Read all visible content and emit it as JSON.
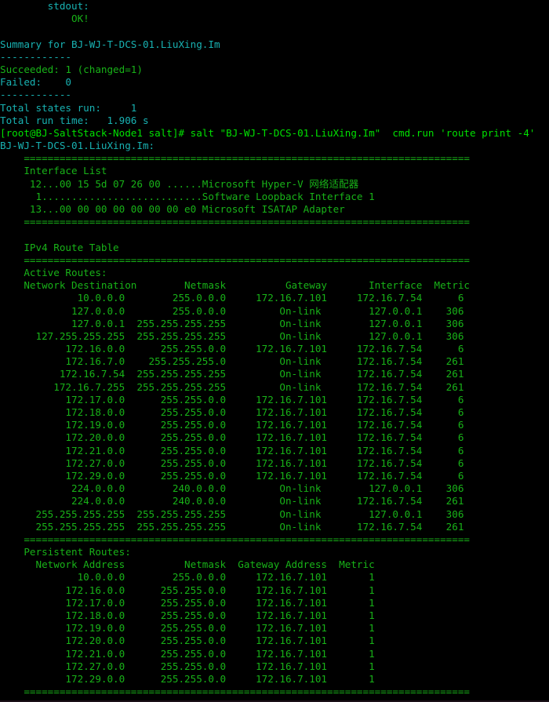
{
  "terminal": {
    "background": "#000000",
    "colors": {
      "cyan": "#18b2b2",
      "green": "#18b218",
      "bright_green": "#00e000"
    },
    "lines": [
      {
        "id": "l01",
        "segments": [
          {
            "text": "        stdout:",
            "color": "cyan"
          }
        ]
      },
      {
        "id": "l02",
        "segments": [
          {
            "text": "            OK!",
            "color": "green"
          }
        ]
      },
      {
        "id": "l03",
        "segments": [
          {
            "text": "",
            "color": "green"
          }
        ]
      },
      {
        "id": "l04",
        "segments": [
          {
            "text": "Summary for BJ-WJ-T-DCS-01.LiuXing.Im",
            "color": "cyan"
          }
        ]
      },
      {
        "id": "l05",
        "segments": [
          {
            "text": "------------",
            "color": "cyan"
          }
        ]
      },
      {
        "id": "l06",
        "segments": [
          {
            "text": "Succeeded: 1 (changed=1)",
            "color": "green"
          }
        ]
      },
      {
        "id": "l07",
        "segments": [
          {
            "text": "Failed:    0",
            "color": "cyan"
          }
        ]
      },
      {
        "id": "l08",
        "segments": [
          {
            "text": "------------",
            "color": "cyan"
          }
        ]
      },
      {
        "id": "l09",
        "segments": [
          {
            "text": "Total states run:     1",
            "color": "cyan"
          }
        ]
      },
      {
        "id": "l10",
        "segments": [
          {
            "text": "Total run time:   1.906 s",
            "color": "cyan"
          }
        ]
      },
      {
        "id": "l11",
        "segments": [
          {
            "text": "[root@BJ-SaltStack-Node1 salt]# salt \"BJ-WJ-T-DCS-01.LiuXing.Im\"  cmd.run 'route print -4'",
            "color": "bright_green"
          }
        ]
      },
      {
        "id": "l12",
        "segments": [
          {
            "text": "BJ-WJ-T-DCS-01.LiuXing.Im:",
            "color": "cyan"
          }
        ]
      },
      {
        "id": "l13",
        "segments": [
          {
            "text": "    ===========================================================================",
            "color": "green"
          }
        ]
      },
      {
        "id": "l14",
        "segments": [
          {
            "text": "    Interface List",
            "color": "green"
          }
        ]
      },
      {
        "id": "l15",
        "segments": [
          {
            "text": "     12...00 15 5d 07 26 00 ......Microsoft Hyper-V 网络适配器",
            "color": "green"
          }
        ]
      },
      {
        "id": "l16",
        "segments": [
          {
            "text": "      1...........................Software Loopback Interface 1",
            "color": "green"
          }
        ]
      },
      {
        "id": "l17",
        "segments": [
          {
            "text": "     13...00 00 00 00 00 00 00 e0 Microsoft ISATAP Adapter",
            "color": "green"
          }
        ]
      },
      {
        "id": "l18",
        "segments": [
          {
            "text": "    ===========================================================================",
            "color": "green"
          }
        ]
      },
      {
        "id": "l19",
        "segments": [
          {
            "text": "",
            "color": "green"
          }
        ]
      },
      {
        "id": "l20",
        "segments": [
          {
            "text": "    IPv4 Route Table",
            "color": "green"
          }
        ]
      },
      {
        "id": "l21",
        "segments": [
          {
            "text": "    ===========================================================================",
            "color": "green"
          }
        ]
      },
      {
        "id": "l22",
        "segments": [
          {
            "text": "    Active Routes:",
            "color": "green"
          }
        ]
      },
      {
        "id": "l23",
        "segments": [
          {
            "text": "    Network Destination        Netmask          Gateway       Interface  Metric",
            "color": "green"
          }
        ]
      },
      {
        "id": "l24",
        "segments": [
          {
            "text": "             10.0.0.0        255.0.0.0     172.16.7.101     172.16.7.54      6",
            "color": "green"
          }
        ]
      },
      {
        "id": "l25",
        "segments": [
          {
            "text": "            127.0.0.0        255.0.0.0         On-link        127.0.0.1    306",
            "color": "green"
          }
        ]
      },
      {
        "id": "l26",
        "segments": [
          {
            "text": "            127.0.0.1  255.255.255.255         On-link        127.0.0.1    306",
            "color": "green"
          }
        ]
      },
      {
        "id": "l27",
        "segments": [
          {
            "text": "      127.255.255.255  255.255.255.255         On-link        127.0.0.1    306",
            "color": "green"
          }
        ]
      },
      {
        "id": "l28",
        "segments": [
          {
            "text": "           172.16.0.0      255.255.0.0     172.16.7.101     172.16.7.54      6",
            "color": "green"
          }
        ]
      },
      {
        "id": "l29",
        "segments": [
          {
            "text": "           172.16.7.0    255.255.255.0         On-link      172.16.7.54    261",
            "color": "green"
          }
        ]
      },
      {
        "id": "l30",
        "segments": [
          {
            "text": "          172.16.7.54  255.255.255.255         On-link      172.16.7.54    261",
            "color": "green"
          }
        ]
      },
      {
        "id": "l31",
        "segments": [
          {
            "text": "         172.16.7.255  255.255.255.255         On-link      172.16.7.54    261",
            "color": "green"
          }
        ]
      },
      {
        "id": "l32",
        "segments": [
          {
            "text": "           172.17.0.0      255.255.0.0     172.16.7.101     172.16.7.54      6",
            "color": "green"
          }
        ]
      },
      {
        "id": "l33",
        "segments": [
          {
            "text": "           172.18.0.0      255.255.0.0     172.16.7.101     172.16.7.54      6",
            "color": "green"
          }
        ]
      },
      {
        "id": "l34",
        "segments": [
          {
            "text": "           172.19.0.0      255.255.0.0     172.16.7.101     172.16.7.54      6",
            "color": "green"
          }
        ]
      },
      {
        "id": "l35",
        "segments": [
          {
            "text": "           172.20.0.0      255.255.0.0     172.16.7.101     172.16.7.54      6",
            "color": "green"
          }
        ]
      },
      {
        "id": "l36",
        "segments": [
          {
            "text": "           172.21.0.0      255.255.0.0     172.16.7.101     172.16.7.54      6",
            "color": "green"
          }
        ]
      },
      {
        "id": "l37",
        "segments": [
          {
            "text": "           172.27.0.0      255.255.0.0     172.16.7.101     172.16.7.54      6",
            "color": "green"
          }
        ]
      },
      {
        "id": "l38",
        "segments": [
          {
            "text": "           172.29.0.0      255.255.0.0     172.16.7.101     172.16.7.54      6",
            "color": "green"
          }
        ]
      },
      {
        "id": "l39",
        "segments": [
          {
            "text": "            224.0.0.0        240.0.0.0         On-link        127.0.0.1    306",
            "color": "green"
          }
        ]
      },
      {
        "id": "l40",
        "segments": [
          {
            "text": "            224.0.0.0        240.0.0.0         On-link      172.16.7.54    261",
            "color": "green"
          }
        ]
      },
      {
        "id": "l41",
        "segments": [
          {
            "text": "      255.255.255.255  255.255.255.255         On-link        127.0.0.1    306",
            "color": "green"
          }
        ]
      },
      {
        "id": "l42",
        "segments": [
          {
            "text": "      255.255.255.255  255.255.255.255         On-link      172.16.7.54    261",
            "color": "green"
          }
        ]
      },
      {
        "id": "l43",
        "segments": [
          {
            "text": "    ===========================================================================",
            "color": "green"
          }
        ]
      },
      {
        "id": "l44",
        "segments": [
          {
            "text": "    Persistent Routes:",
            "color": "green"
          }
        ]
      },
      {
        "id": "l45",
        "segments": [
          {
            "text": "      Network Address          Netmask  Gateway Address  Metric",
            "color": "green"
          }
        ]
      },
      {
        "id": "l46",
        "segments": [
          {
            "text": "             10.0.0.0        255.0.0.0     172.16.7.101       1",
            "color": "green"
          }
        ]
      },
      {
        "id": "l47",
        "segments": [
          {
            "text": "           172.16.0.0      255.255.0.0     172.16.7.101       1",
            "color": "green"
          }
        ]
      },
      {
        "id": "l48",
        "segments": [
          {
            "text": "           172.17.0.0      255.255.0.0     172.16.7.101       1",
            "color": "green"
          }
        ]
      },
      {
        "id": "l49",
        "segments": [
          {
            "text": "           172.18.0.0      255.255.0.0     172.16.7.101       1",
            "color": "green"
          }
        ]
      },
      {
        "id": "l50",
        "segments": [
          {
            "text": "           172.19.0.0      255.255.0.0     172.16.7.101       1",
            "color": "green"
          }
        ]
      },
      {
        "id": "l51",
        "segments": [
          {
            "text": "           172.20.0.0      255.255.0.0     172.16.7.101       1",
            "color": "green"
          }
        ]
      },
      {
        "id": "l52",
        "segments": [
          {
            "text": "           172.21.0.0      255.255.0.0     172.16.7.101       1",
            "color": "green"
          }
        ]
      },
      {
        "id": "l53",
        "segments": [
          {
            "text": "           172.27.0.0      255.255.0.0     172.16.7.101       1",
            "color": "green"
          }
        ]
      },
      {
        "id": "l54",
        "segments": [
          {
            "text": "           172.29.0.0      255.255.0.0     172.16.7.101       1",
            "color": "green"
          }
        ]
      },
      {
        "id": "l55",
        "segments": [
          {
            "text": "    ===========================================================================",
            "color": "green"
          }
        ]
      }
    ]
  },
  "salt_summary": {
    "stdout_label": "stdout:",
    "stdout_value": "OK!",
    "summary_title": "Summary for BJ-WJ-T-DCS-01.LiuXing.Im",
    "succeeded": "Succeeded: 1 (changed=1)",
    "failed": "Failed:    0",
    "total_states_run": "Total states run:     1",
    "total_run_time": "Total run time:   1.906 s",
    "minion_id": "BJ-WJ-T-DCS-01.LiuXing.Im"
  },
  "prompt": {
    "user_host": "[root@BJ-SaltStack-Node1 salt]#",
    "command": "salt \"BJ-WJ-T-DCS-01.LiuXing.Im\"  cmd.run 'route print -4'"
  },
  "interface_list": {
    "title": "Interface List",
    "entries": [
      {
        "index": "12",
        "mac": "00 15 5d 07 26 00",
        "description": "Microsoft Hyper-V 网络适配器"
      },
      {
        "index": "1",
        "mac": "",
        "description": "Software Loopback Interface 1"
      },
      {
        "index": "13",
        "mac": "00 00 00 00 00 00 00 e0",
        "description": "Microsoft ISATAP Adapter"
      }
    ]
  },
  "ipv4_route_table": {
    "title": "IPv4 Route Table",
    "active_routes_label": "Active Routes:",
    "columns": [
      "Network Destination",
      "Netmask",
      "Gateway",
      "Interface",
      "Metric"
    ],
    "rows": [
      [
        "10.0.0.0",
        "255.0.0.0",
        "172.16.7.101",
        "172.16.7.54",
        "6"
      ],
      [
        "127.0.0.0",
        "255.0.0.0",
        "On-link",
        "127.0.0.1",
        "306"
      ],
      [
        "127.0.0.1",
        "255.255.255.255",
        "On-link",
        "127.0.0.1",
        "306"
      ],
      [
        "127.255.255.255",
        "255.255.255.255",
        "On-link",
        "127.0.0.1",
        "306"
      ],
      [
        "172.16.0.0",
        "255.255.0.0",
        "172.16.7.101",
        "172.16.7.54",
        "6"
      ],
      [
        "172.16.7.0",
        "255.255.255.0",
        "On-link",
        "172.16.7.54",
        "261"
      ],
      [
        "172.16.7.54",
        "255.255.255.255",
        "On-link",
        "172.16.7.54",
        "261"
      ],
      [
        "172.16.7.255",
        "255.255.255.255",
        "On-link",
        "172.16.7.54",
        "261"
      ],
      [
        "172.17.0.0",
        "255.255.0.0",
        "172.16.7.101",
        "172.16.7.54",
        "6"
      ],
      [
        "172.18.0.0",
        "255.255.0.0",
        "172.16.7.101",
        "172.16.7.54",
        "6"
      ],
      [
        "172.19.0.0",
        "255.255.0.0",
        "172.16.7.101",
        "172.16.7.54",
        "6"
      ],
      [
        "172.20.0.0",
        "255.255.0.0",
        "172.16.7.101",
        "172.16.7.54",
        "6"
      ],
      [
        "172.21.0.0",
        "255.255.0.0",
        "172.16.7.101",
        "172.16.7.54",
        "6"
      ],
      [
        "172.27.0.0",
        "255.255.0.0",
        "172.16.7.101",
        "172.16.7.54",
        "6"
      ],
      [
        "172.29.0.0",
        "255.255.0.0",
        "172.16.7.101",
        "172.16.7.54",
        "6"
      ],
      [
        "224.0.0.0",
        "240.0.0.0",
        "On-link",
        "127.0.0.1",
        "306"
      ],
      [
        "224.0.0.0",
        "240.0.0.0",
        "On-link",
        "172.16.7.54",
        "261"
      ],
      [
        "255.255.255.255",
        "255.255.255.255",
        "On-link",
        "127.0.0.1",
        "306"
      ],
      [
        "255.255.255.255",
        "255.255.255.255",
        "On-link",
        "172.16.7.54",
        "261"
      ]
    ]
  },
  "persistent_routes": {
    "label": "Persistent Routes:",
    "columns": [
      "Network Address",
      "Netmask",
      "Gateway Address",
      "Metric"
    ],
    "rows": [
      [
        "10.0.0.0",
        "255.0.0.0",
        "172.16.7.101",
        "1"
      ],
      [
        "172.16.0.0",
        "255.255.0.0",
        "172.16.7.101",
        "1"
      ],
      [
        "172.17.0.0",
        "255.255.0.0",
        "172.16.7.101",
        "1"
      ],
      [
        "172.18.0.0",
        "255.255.0.0",
        "172.16.7.101",
        "1"
      ],
      [
        "172.19.0.0",
        "255.255.0.0",
        "172.16.7.101",
        "1"
      ],
      [
        "172.20.0.0",
        "255.255.0.0",
        "172.16.7.101",
        "1"
      ],
      [
        "172.21.0.0",
        "255.255.0.0",
        "172.16.7.101",
        "1"
      ],
      [
        "172.27.0.0",
        "255.255.0.0",
        "172.16.7.101",
        "1"
      ],
      [
        "172.29.0.0",
        "255.255.0.0",
        "172.16.7.101",
        "1"
      ]
    ]
  }
}
